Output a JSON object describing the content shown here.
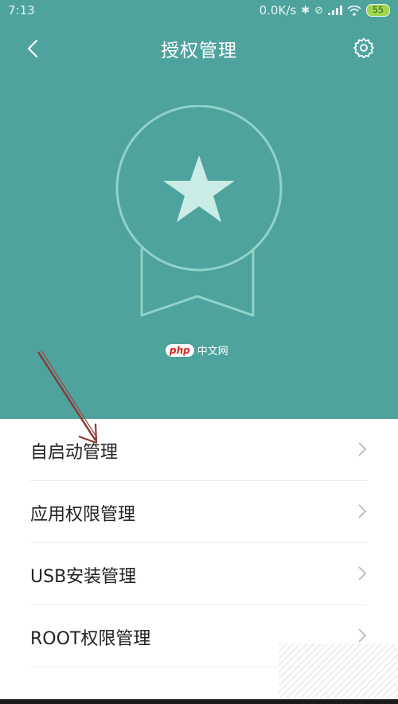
{
  "status_bar": {
    "time": "7:13",
    "network_speed": "0.0K/s",
    "battery": "55",
    "icons": [
      "bluetooth-icon",
      "mute-icon",
      "signal-icon",
      "wifi-icon",
      "battery-icon"
    ]
  },
  "title_bar": {
    "title": "授权管理",
    "back_icon": "chevron-left-icon",
    "settings_icon": "gear-icon"
  },
  "watermark": {
    "logo": "php",
    "text": "中文网"
  },
  "colors": {
    "header_bg": "#4ea39d",
    "badge_stroke": "#8fd3c8",
    "star_fill": "#c9ece6",
    "arrow": "#8b3a3a"
  },
  "menu": {
    "items": [
      {
        "label": "自启动管理"
      },
      {
        "label": "应用权限管理"
      },
      {
        "label": "USB安装管理"
      },
      {
        "label": "ROOT权限管理"
      }
    ]
  }
}
